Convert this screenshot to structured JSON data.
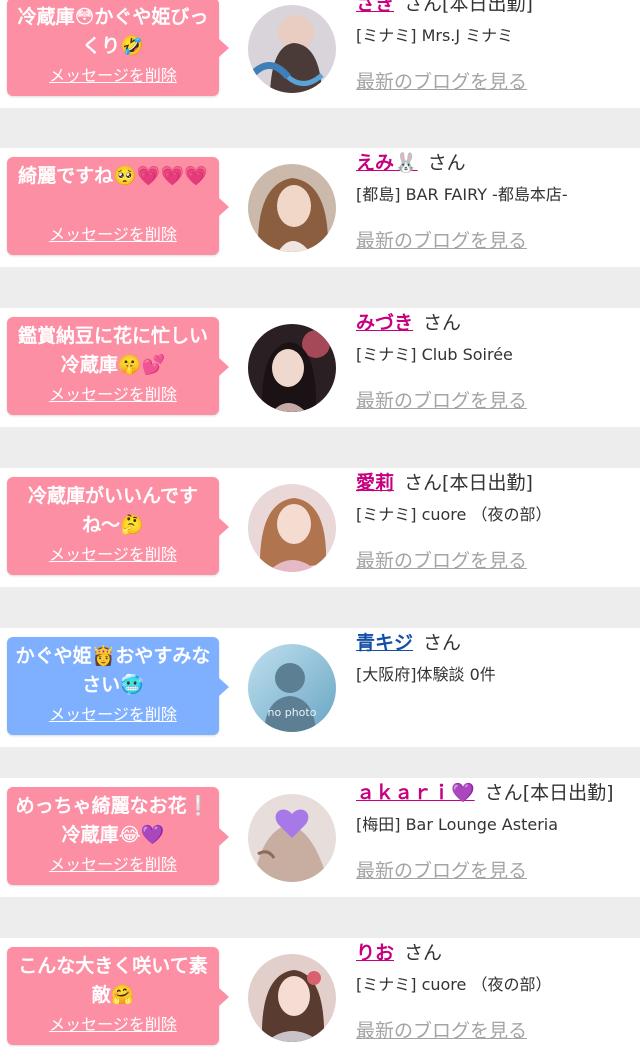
{
  "colors": {
    "pink_bubble": "#fd8fa5",
    "blue_bubble": "#7fb0ff",
    "name_pink": "#c6007e",
    "name_blue": "#144fa6",
    "blog_link": "#a4a4a4",
    "separator": "#ededed"
  },
  "messages": [
    {
      "message": "冷蔵庫😳かぐや姫びっくり🤣",
      "delete_label": "メッセージを削除",
      "bubble_color": "pink",
      "name": "さき",
      "honorific": "さん",
      "status": "[本日出勤]",
      "shop": "[ミナミ] Mrs.J ミナミ",
      "blog_link": "最新のブログを見る"
    },
    {
      "message": "綺麗ですね🥺💗💗💗",
      "delete_label": "メッセージを削除",
      "bubble_color": "pink",
      "name": "えみ🐰",
      "honorific": "さん",
      "status": "",
      "shop": "[都島] BAR FAIRY -都島本店-",
      "blog_link": "最新のブログを見る"
    },
    {
      "message": "鑑賞納豆に花に忙しい冷蔵庫🤫💕",
      "delete_label": "メッセージを削除",
      "bubble_color": "pink",
      "name": "みづき",
      "honorific": "さん",
      "status": "",
      "shop": "[ミナミ] Club Soirée",
      "blog_link": "最新のブログを見る"
    },
    {
      "message": "冷蔵庫がいいんですね〜🤔",
      "delete_label": "メッセージを削除",
      "bubble_color": "pink",
      "name": "愛莉",
      "honorific": "さん",
      "status": "[本日出勤]",
      "shop": "[ミナミ] cuore （夜の部）",
      "blog_link": "最新のブログを見る"
    },
    {
      "message": "かぐや姫👸おやすみなさい🥶",
      "delete_label": "メッセージを削除",
      "bubble_color": "blue",
      "name": "青キジ",
      "honorific": "さん",
      "status": "",
      "shop": "[大阪府]体験談 0件",
      "blog_link": "",
      "avatar_text": "no photo"
    },
    {
      "message": "めっちゃ綺麗なお花❕冷蔵庫😂💜",
      "delete_label": "メッセージを削除",
      "bubble_color": "pink",
      "name": "ａｋａｒｉ💜",
      "honorific": "さん",
      "status": "[本日出勤]",
      "shop": "[梅田] Bar Lounge Asteria",
      "blog_link": "最新のブログを見る"
    },
    {
      "message": "こんな大きく咲いて素敵🤗",
      "delete_label": "メッセージを削除",
      "bubble_color": "pink",
      "name": "りお",
      "honorific": "さん",
      "status": "",
      "shop": "[ミナミ] cuore （夜の部）",
      "blog_link": "最新のブログを見る"
    }
  ]
}
